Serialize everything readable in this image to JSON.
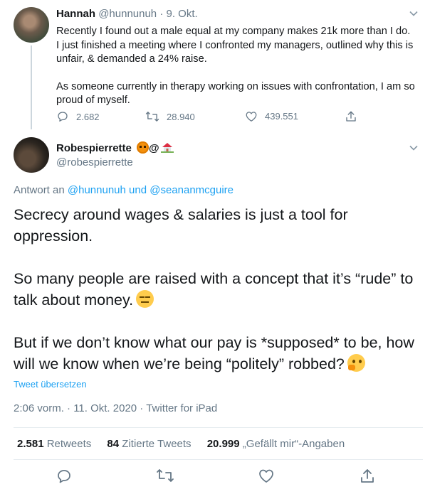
{
  "reply_tweet": {
    "display_name": "Hannah",
    "handle": "@hunnunuh",
    "separator": "·",
    "date": "9. Okt.",
    "paragraphs": [
      "Recently I found out a male equal at my company makes 21k more than I do. I just finished a meeting where I confronted my managers, outlined why this is unfair, & demanded a 24% raise.",
      "As someone currently in therapy working on issues with confrontation, I am so proud of myself."
    ],
    "replies": "2.682",
    "retweets": "28.940",
    "likes": "439.551"
  },
  "main_tweet": {
    "display_name": "Robespierrette",
    "name_suffix": "@",
    "handle": "@robespierrette",
    "replying_prefix": "Antwort an",
    "replying_user1": "@hunnunuh",
    "replying_and": "und",
    "replying_user2": "@seananmcguire",
    "paragraphs": [
      "Secrecy around wages & salaries is just a tool for oppression.",
      "So many people are raised with a concept that it’s “rude” to talk about money.",
      "But if we don’t know what our pay is *supposed* to be, how will we know when we’re being “politely” robbed?"
    ],
    "translate_label": "Tweet übersetzen",
    "timestamp": "2:06 vorm. · 11. Okt. 2020 · Twitter for iPad",
    "stats": {
      "retweets_count": "2.581",
      "retweets_label": "Retweets",
      "quotes_count": "84",
      "quotes_label": "Zitierte Tweets",
      "likes_count": "20.999",
      "likes_label": "„Gefällt mir“-Angaben"
    }
  },
  "icons": [
    "chevron-down-icon",
    "reply-icon",
    "retweet-icon",
    "like-icon",
    "share-icon"
  ],
  "colors": {
    "accent": "#1da1f2",
    "secondary_text": "#657786",
    "text": "#14171a",
    "divider": "#e6ecf0"
  }
}
